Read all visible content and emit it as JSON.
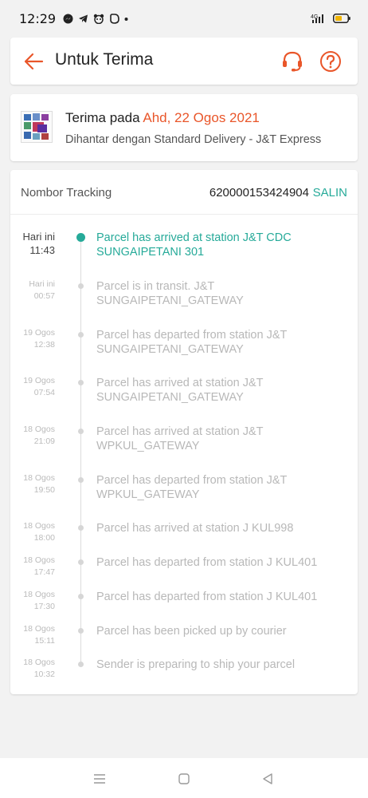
{
  "status_bar": {
    "time": "12:29",
    "network": "4G",
    "icons": [
      "messenger-icon",
      "telegram-icon",
      "foodpanda-icon",
      "app-icon",
      "dot-icon"
    ]
  },
  "header": {
    "title": "Untuk Terima",
    "back_icon": "arrow-left-icon",
    "support_icon": "headset-icon",
    "help_icon": "question-circle-icon"
  },
  "delivery": {
    "received_prefix": "Terima pada",
    "received_date": "Ahd, 22 Ogos 2021",
    "shipping_text": "Dihantar dengan Standard Delivery  - J&T Express"
  },
  "tracking": {
    "label": "Nombor Tracking",
    "number": "620000153424904",
    "copy_label": "SALIN",
    "events": [
      {
        "date": "Hari ini",
        "time": "11:43",
        "description": "Parcel has arrived at station J&T CDC SUNGAIPETANI 301",
        "active": true
      },
      {
        "date": "Hari ini",
        "time": "00:57",
        "description": "Parcel is in transit. J&T SUNGAIPETANI_GATEWAY",
        "active": false
      },
      {
        "date": "19 Ogos",
        "time": "12:38",
        "description": "Parcel has departed from station J&T SUNGAIPETANI_GATEWAY",
        "active": false
      },
      {
        "date": "19 Ogos",
        "time": "07:54",
        "description": "Parcel has arrived at station J&T SUNGAIPETANI_GATEWAY",
        "active": false
      },
      {
        "date": "18 Ogos",
        "time": "21:09",
        "description": "Parcel has arrived at station J&T WPKUL_GATEWAY",
        "active": false
      },
      {
        "date": "18 Ogos",
        "time": "19:50",
        "description": "Parcel has departed from station J&T WPKUL_GATEWAY",
        "active": false
      },
      {
        "date": "18 Ogos",
        "time": "18:00",
        "description": "Parcel has arrived at station J KUL998",
        "active": false
      },
      {
        "date": "18 Ogos",
        "time": "17:47",
        "description": "Parcel has departed from station J KUL401",
        "active": false
      },
      {
        "date": "18 Ogos",
        "time": "17:30",
        "description": "Parcel has departed from station J KUL401",
        "active": false
      },
      {
        "date": "18 Ogos",
        "time": "15:11",
        "description": "Parcel has been picked up by courier",
        "active": false
      },
      {
        "date": "18 Ogos",
        "time": "10:32",
        "description": "Sender is preparing to ship your parcel",
        "active": false
      }
    ]
  },
  "colors": {
    "accent_orange": "#e9562a",
    "accent_teal": "#26aa99",
    "background": "#f2f2f2"
  },
  "navbar": {
    "icons": [
      "menu-icon",
      "home-square-icon",
      "back-triangle-icon"
    ]
  }
}
